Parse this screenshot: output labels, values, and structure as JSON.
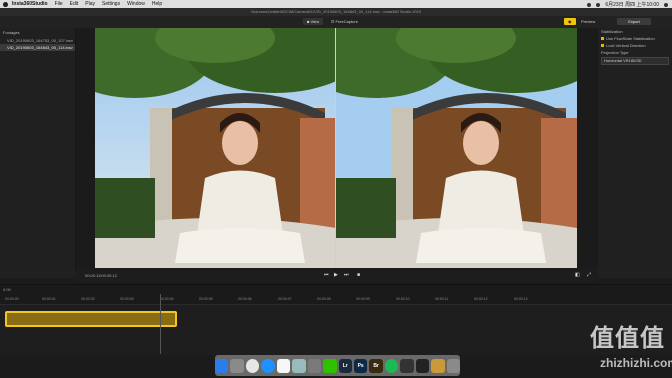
{
  "menubar": {
    "items": [
      "Insta360Studio",
      "File",
      "Edit",
      "Play",
      "Settings",
      "Window",
      "Help"
    ],
    "status_text": "6月23日 周四 上午10:00"
  },
  "window": {
    "title": "/Volumes/Untitled/DCIM/Camera01/VID_20190603_164843_00_114.insv - Insta360 Studio 2019"
  },
  "toolbar": {
    "view_label": "View",
    "freecapture_label": "FreeCapture",
    "preview_label": "Preview",
    "export_label": "Export"
  },
  "sidebar": {
    "header": "Footages",
    "files": [
      {
        "name": "VID_20190603_164753_00_107.insv",
        "selected": false
      },
      {
        "name": "VID_20190603_164843_00_114.insv",
        "selected": true
      }
    ]
  },
  "rightpanel": {
    "stabilization_label": "Stabilization",
    "flowstate_label": "Use FlowState Stabilization",
    "lock_direction_label": "Lock Vertical Direction",
    "projection_label": "Projection Type",
    "projection_value": "Horizontal VR180/3D"
  },
  "controls": {
    "timecode": "00:00:11/00:00:12"
  },
  "timeline": {
    "label": "0:00",
    "ticks": [
      "00:00:00",
      "00:00:01",
      "00:00:02",
      "00:00:03",
      "00:00:04",
      "00:00:05",
      "00:00:06",
      "00:00:07",
      "00:00:08",
      "00:00:09",
      "00:00:10",
      "00:00:11",
      "00:00:12",
      "00:00:13"
    ]
  },
  "dock": {
    "apps": [
      {
        "name": "Finder",
        "label": "",
        "color": "#2b7de9"
      },
      {
        "name": "Launchpad",
        "label": "",
        "color": "#8a8a8a"
      },
      {
        "name": "Chrome",
        "label": "",
        "color": "#e6e6e6"
      },
      {
        "name": "Safari",
        "label": "",
        "color": "#1e90ff"
      },
      {
        "name": "Notes",
        "label": "",
        "color": "#f7f7f7"
      },
      {
        "name": "Preview",
        "label": "",
        "color": "#9bb"
      },
      {
        "name": "System",
        "label": "",
        "color": "#7a7a7a"
      },
      {
        "name": "WeChat",
        "label": "",
        "color": "#2dc100"
      },
      {
        "name": "Lightroom",
        "label": "Lr",
        "color": "#1b2a3a"
      },
      {
        "name": "Photoshop",
        "label": "Ps",
        "color": "#0e2a47"
      },
      {
        "name": "Bridge",
        "label": "Br",
        "color": "#3a2a10"
      },
      {
        "name": "Spotify",
        "label": "",
        "color": "#1db954"
      },
      {
        "name": "Terminal",
        "label": "",
        "color": "#333"
      },
      {
        "name": "Insta360",
        "label": "",
        "color": "#222"
      },
      {
        "name": "Archive",
        "label": "",
        "color": "#c89a3a"
      },
      {
        "name": "Trash",
        "label": "",
        "color": "#8a8a8a"
      }
    ]
  },
  "watermark": {
    "top": "值值值",
    "bottom": "zhizhizhi.com"
  }
}
